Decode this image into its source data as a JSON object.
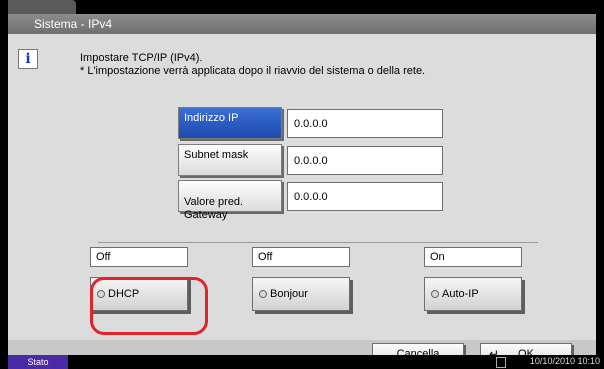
{
  "header": {
    "title": "Sistema - IPv4"
  },
  "info": {
    "line1": "Impostare TCP/IP (IPv4).",
    "line2": "* L'impostazione verrà applicata dopo il riavvio del sistema o della rete."
  },
  "fields": [
    {
      "label": "Indirizzo IP",
      "value": "0.0.0.0"
    },
    {
      "label": "Subnet mask",
      "value": "0.0.0.0"
    },
    {
      "label": "Valore pred.\nGateway",
      "value": "0.0.0.0"
    }
  ],
  "modes": [
    {
      "state": "Off",
      "label": "DHCP"
    },
    {
      "state": "Off",
      "label": "Bonjour"
    },
    {
      "state": "On",
      "label": "Auto-IP"
    }
  ],
  "actions": {
    "cancel": "Cancella",
    "ok": "OK"
  },
  "status": {
    "button": "Stato",
    "datetime": "10/10/2010 10:10"
  },
  "colors": {
    "selected": "#1f49ad",
    "highlight": "#e0242b",
    "status_button": "#4b2aa7"
  }
}
